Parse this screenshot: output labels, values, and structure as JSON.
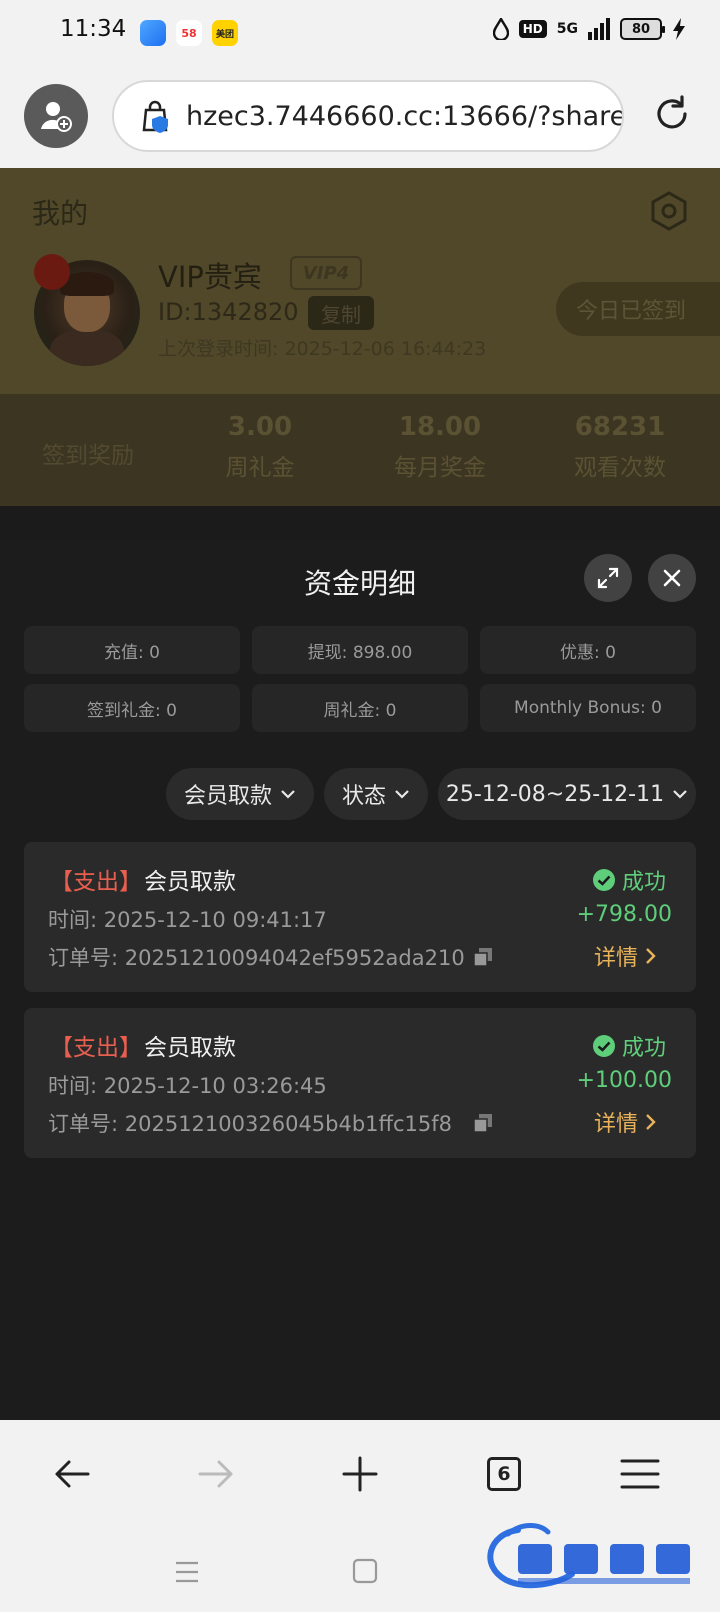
{
  "status_bar": {
    "time": "11:34",
    "apps": [
      "",
      "58",
      "美团"
    ],
    "network": "5G",
    "battery": "80"
  },
  "browser": {
    "url": "hzec3.7446660.cc:13666/?shareN",
    "tab_count": "6"
  },
  "page": {
    "title": "我的",
    "user": {
      "name": "VIP贵宾",
      "vip_badge": "VIP4",
      "id": "ID:1342820",
      "copy_label": "复制",
      "last_login": "上次登录时间:  2025-12-06 16:44:23",
      "signin_button": "今日已签到"
    },
    "stats": {
      "signin_label": "签到奖励",
      "items": [
        {
          "value": "3.00",
          "label": "周礼金"
        },
        {
          "value": "18.00",
          "label": "每月奖金"
        },
        {
          "value": "68231",
          "label": "观看次数"
        }
      ]
    }
  },
  "modal": {
    "title": "资金明细",
    "summary": [
      "充值: 0",
      "提现: 898.00",
      "优惠: 0",
      "签到礼金: 0",
      "周礼金: 0",
      "Monthly Bonus: 0"
    ],
    "filters": {
      "type": "会员取款",
      "status": "状态",
      "date_range": "25-12-08~25-12-11"
    },
    "records": [
      {
        "type": "【支出】",
        "name": "会员取款",
        "time": "时间:  2025-12-10 09:41:17",
        "order": "订单号:  20251210094042ef5952ada210",
        "status": "成功",
        "amount": "+798.00",
        "detail": "详情"
      },
      {
        "type": "【支出】",
        "name": "会员取款",
        "time": "时间:  2025-12-10 03:26:45",
        "order": "订单号:  202512100326045b4b1ffc15f8",
        "status": "成功",
        "amount": "+100.00",
        "detail": "详情"
      }
    ]
  },
  "colors": {
    "accent_gold": "#e8b35a",
    "success_green": "#5fce7b",
    "expense_red": "#e85f4f"
  }
}
